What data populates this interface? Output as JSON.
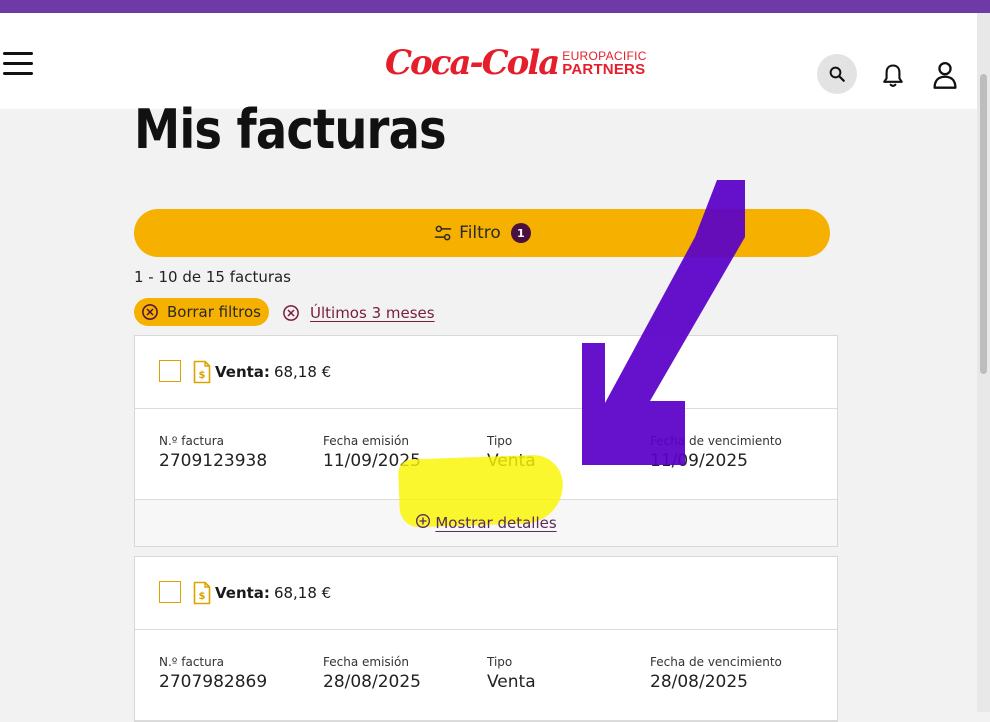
{
  "header": {
    "logo_script": "Coca-Cola",
    "logo_top": "EUROPACIFIC",
    "logo_bottom": "PARTNERS"
  },
  "page": {
    "title": "Mis facturas"
  },
  "filter": {
    "label": "Filtro",
    "count": "1"
  },
  "results": {
    "count_text": "1 - 10 de 15 facturas"
  },
  "chips": {
    "clear_label": "Borrar filtros",
    "range_label": "Últimos 3 meses"
  },
  "labels": {
    "invoice_no": "N.º factura",
    "issue_date": "Fecha emisión",
    "type": "Tipo",
    "due_date": "Fecha de vencimiento",
    "show_details": "Mostrar detalles",
    "sale": "Venta:"
  },
  "invoices": [
    {
      "amount": "68,18 €",
      "number": "2709123938",
      "issue_date": "11/09/2025",
      "type": "Venta",
      "due_date": "11/09/2025"
    },
    {
      "amount": "68,18 €",
      "number": "2707982869",
      "issue_date": "28/08/2025",
      "type": "Venta",
      "due_date": "28/08/2025"
    }
  ],
  "icons": {
    "menu": "hamburger-icon",
    "search": "search-icon",
    "notifications": "bell-icon",
    "account": "user-icon",
    "filter": "sliders-icon",
    "close": "circle-x-icon",
    "document": "invoice-document-icon",
    "expand": "circle-plus-icon"
  },
  "colors": {
    "brand_red": "#e41e2b",
    "accent_yellow": "#f5b000",
    "badge_purple": "#4a1040",
    "link_maroon": "#7a1d3a",
    "top_bar": "#6d3aa6",
    "annotation_arrow": "#5a00c8",
    "annotation_highlight": "#faf500"
  }
}
